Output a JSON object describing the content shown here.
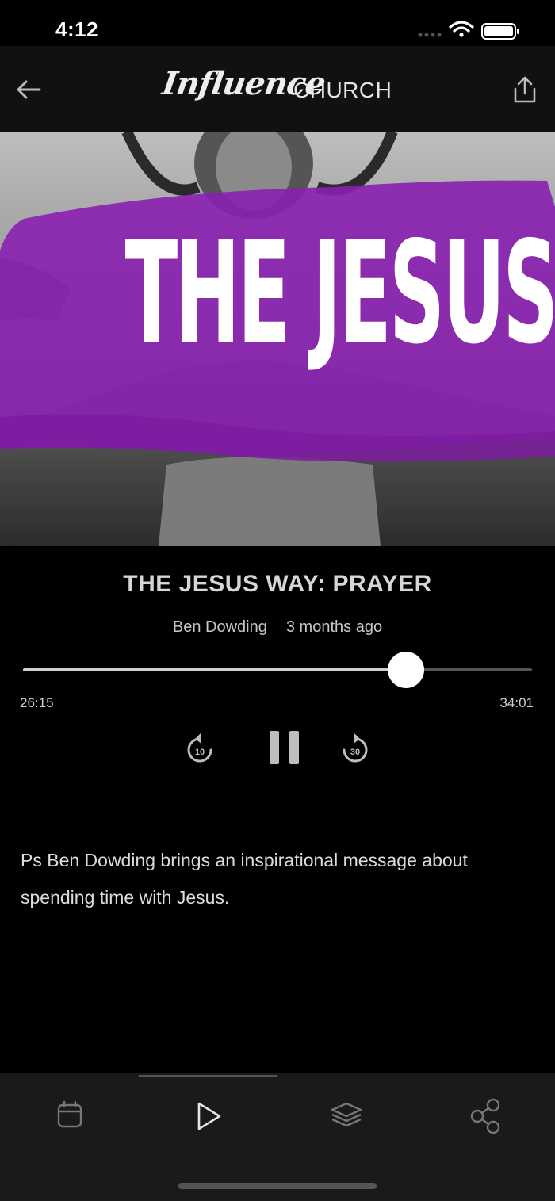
{
  "status_bar": {
    "time": "4:12"
  },
  "header": {
    "logo_script": "Influence",
    "logo_word": "CHURCH",
    "back_icon": "arrow-left-icon",
    "share_icon": "share-upload-icon"
  },
  "artwork": {
    "headline": "THE JESUS WAY",
    "accent_color": "#8a1fb0"
  },
  "sermon": {
    "title": "THE JESUS WAY: PRAYER",
    "speaker": "Ben Dowding",
    "date": "3 months ago",
    "description": "Ps Ben Dowding brings an inspirational message about spending time with Jesus."
  },
  "player": {
    "elapsed": "26:15",
    "total": "34:01",
    "progress_fraction": 0.752,
    "rewind_label": "10",
    "forward_label": "30",
    "rewind_icon": "rewind-10-icon",
    "pause_icon": "pause-icon",
    "forward_icon": "forward-30-icon"
  },
  "tab_bar": {
    "tabs": [
      {
        "name": "calendar",
        "icon": "calendar-icon"
      },
      {
        "name": "play",
        "icon": "play-icon",
        "selected": true
      },
      {
        "name": "layers",
        "icon": "layers-icon"
      },
      {
        "name": "connect",
        "icon": "share-nodes-icon"
      }
    ]
  }
}
